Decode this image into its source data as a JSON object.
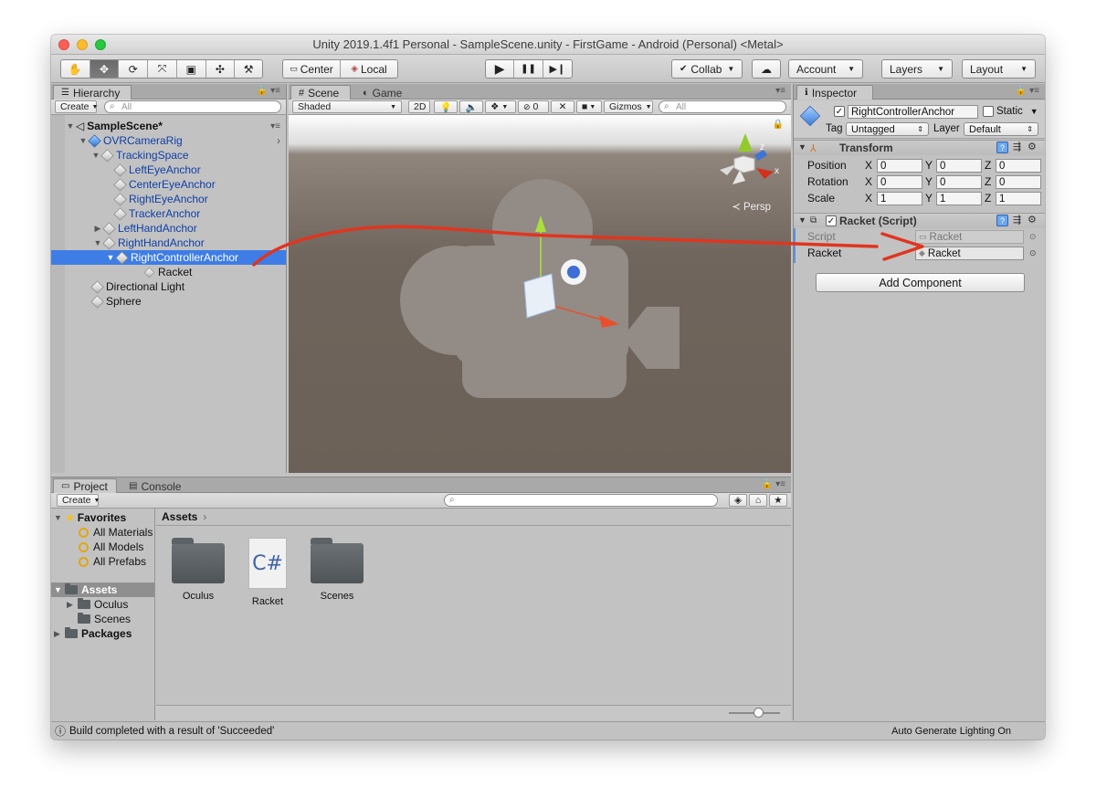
{
  "window": {
    "title": "Unity 2019.1.4f1 Personal - SampleScene.unity - FirstGame - Android (Personal) <Metal>"
  },
  "toolbar": {
    "tools": [
      "hand-tool",
      "move-tool",
      "rotate-tool",
      "scale-tool",
      "rect-tool",
      "transform-tool",
      "custom-tool"
    ],
    "tool_glyphs": [
      "✋",
      "✥",
      "⟳",
      "⤧",
      "▣",
      "✣",
      "⚒"
    ],
    "pivot_label": "Center",
    "space_label": "Local",
    "play_glyph": "▶",
    "pause_glyph": "❚❚",
    "step_glyph": "▶❙",
    "collab_label": "Collab",
    "cloud_glyph": "☁",
    "account_label": "Account",
    "layers_label": "Layers",
    "layout_label": "Layout"
  },
  "hierarchy": {
    "tab_label": "Hierarchy",
    "create_label": "Create",
    "search_placeholder": "All",
    "scene_name": "SampleScene*",
    "items": [
      {
        "label": "OVRCameraRig"
      },
      {
        "label": "TrackingSpace"
      },
      {
        "label": "LeftEyeAnchor"
      },
      {
        "label": "CenterEyeAnchor"
      },
      {
        "label": "RightEyeAnchor"
      },
      {
        "label": "TrackerAnchor"
      },
      {
        "label": "LeftHandAnchor"
      },
      {
        "label": "RightHandAnchor"
      },
      {
        "label": "RightControllerAnchor"
      },
      {
        "label": "Racket"
      },
      {
        "label": "Directional Light"
      },
      {
        "label": "Sphere"
      }
    ]
  },
  "scene": {
    "tab_scene": "Scene",
    "tab_game": "Game",
    "shading_mode": "Shaded",
    "mode_2d": "2D",
    "hidden_count": "0",
    "gizmos_label": "Gizmos",
    "search_placeholder": "All",
    "persp_label": "Persp",
    "axis_x": "x",
    "axis_z": "z"
  },
  "inspector": {
    "tab_label": "Inspector",
    "object_name": "RightControllerAnchor",
    "static_label": "Static",
    "tag_label": "Tag",
    "tag_value": "Untagged",
    "layer_label": "Layer",
    "layer_value": "Default",
    "transform": {
      "title": "Transform",
      "rows": [
        {
          "label": "Position",
          "x": "0",
          "y": "0",
          "z": "0"
        },
        {
          "label": "Rotation",
          "x": "0",
          "y": "0",
          "z": "0"
        },
        {
          "label": "Scale",
          "x": "1",
          "y": "1",
          "z": "1"
        }
      ],
      "axis_x": "X",
      "axis_y": "Y",
      "axis_z": "Z"
    },
    "script_component": {
      "title": "Racket (Script)",
      "script_label": "Script",
      "script_value": "Racket",
      "racket_label": "Racket",
      "racket_value": "Racket"
    },
    "add_component_label": "Add Component"
  },
  "project": {
    "tab_project": "Project",
    "tab_console": "Console",
    "create_label": "Create",
    "favorites_label": "Favorites",
    "favorites": [
      "All Materials",
      "All Models",
      "All Prefabs"
    ],
    "assets_label": "Assets",
    "asset_folders": [
      "Oculus",
      "Scenes"
    ],
    "packages_label": "Packages",
    "breadcrumb": "Assets",
    "assets": [
      {
        "name": "Oculus",
        "kind": "folder"
      },
      {
        "name": "Racket",
        "kind": "csharp",
        "glyph": "C#"
      },
      {
        "name": "Scenes",
        "kind": "folder"
      }
    ]
  },
  "status": {
    "message": "Build completed with a result of 'Succeeded'",
    "lighting": "Auto Generate Lighting On"
  },
  "colors": {
    "selection": "#3e7de6",
    "annotation_arrow": "#e0351f",
    "prefab_blue": "#0f3fa6"
  }
}
